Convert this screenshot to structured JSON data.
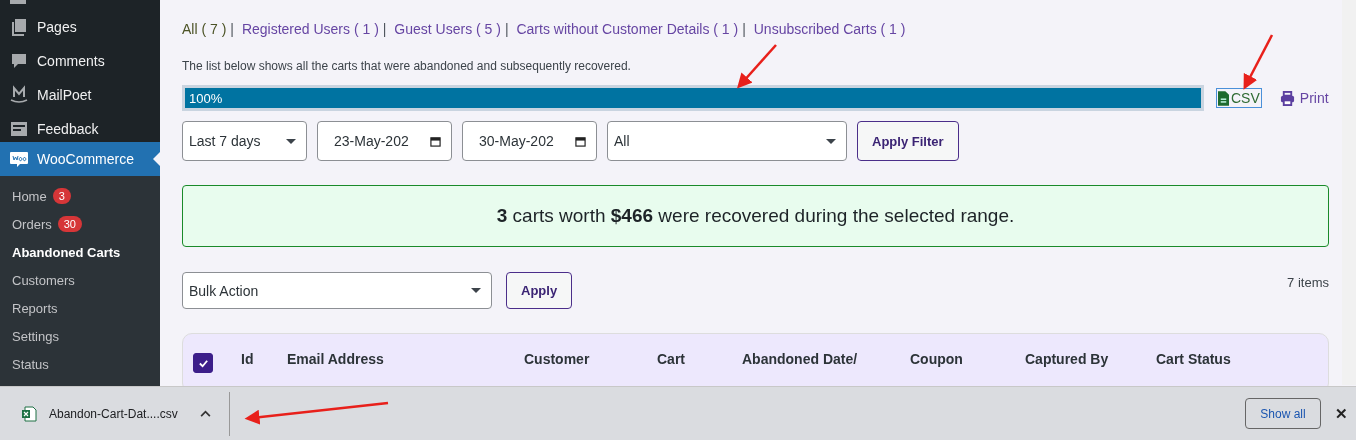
{
  "sidebar": {
    "items": [
      {
        "label": "Pages",
        "selected": false
      },
      {
        "label": "Comments",
        "selected": false
      },
      {
        "label": "MailPoet",
        "selected": false
      },
      {
        "label": "Feedback",
        "selected": false
      },
      {
        "label": "WooCommerce",
        "selected": true
      }
    ],
    "submenu": [
      {
        "label": "Home",
        "selected": false,
        "badge": "3"
      },
      {
        "label": "Orders",
        "selected": false,
        "badge": "30"
      },
      {
        "label": "Abandoned Carts",
        "selected": true
      },
      {
        "label": "Customers",
        "selected": false
      },
      {
        "label": "Reports",
        "selected": false
      },
      {
        "label": "Settings",
        "selected": false
      },
      {
        "label": "Status",
        "selected": false
      }
    ]
  },
  "filter_links": {
    "separator": "|",
    "items": [
      {
        "label": "All ( 7 )",
        "selected": true
      },
      {
        "label": "Registered Users ( 1 )",
        "selected": false
      },
      {
        "label": "Guest Users ( 5 )",
        "selected": false
      },
      {
        "label": "Carts without Customer Details ( 1 )",
        "selected": false
      },
      {
        "label": "Unsubscribed Carts ( 1 )",
        "selected": false
      }
    ]
  },
  "description": "The list below shows all the carts that were abandoned and subsequently recovered.",
  "progress": {
    "label": "100%",
    "level": 1
  },
  "export": {
    "csv": "CSV",
    "print": "Print"
  },
  "filters": {
    "range": "Last 7 days",
    "start_date": "23-May-202",
    "end_date": "30-May-202",
    "type": "All",
    "button": "Apply Filter"
  },
  "summary": "**3** carts worth **$466** were recovered during the selected range.",
  "bulk": {
    "action": "Bulk Action",
    "button": "Apply",
    "count": "7 items"
  },
  "table": {
    "select_all": {
      "checked": true
    },
    "columns": [
      "Id",
      "Email Address",
      "Customer",
      "Cart",
      "Abandoned Date/",
      "Coupon",
      "Captured By",
      "Cart Status"
    ]
  },
  "download_bar": {
    "file": "Abandon-Cart-Dat....csv",
    "show_all": "Show all",
    "close": "✕"
  }
}
